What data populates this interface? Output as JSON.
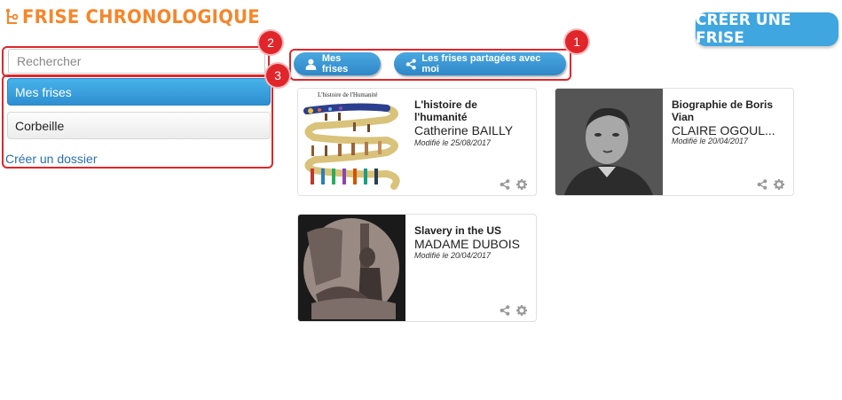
{
  "header": {
    "logo_icon": "timeline-logo-icon",
    "title": "FRISE CHRONOLOGIQUE",
    "create_button": "CRÉER UNE FRISE"
  },
  "sidebar": {
    "search_placeholder": "Rechercher",
    "items": [
      {
        "label": "Mes frises",
        "active": true
      },
      {
        "label": "Corbeille",
        "active": false
      }
    ],
    "create_folder": "Créer un dossier"
  },
  "toolbar": {
    "mine_label": "Mes frises",
    "mine_icon": "user-icon",
    "shared_label": "Les frises partagées avec moi",
    "shared_icon": "share-icon"
  },
  "annotations": [
    "1",
    "2",
    "3"
  ],
  "cards": [
    {
      "title": "L'histoire de l'humanité",
      "author": "Catherine BAILLY",
      "date": "Modifié le 25/08/2017",
      "thumb_caption": "L'histoire de l'Humanité"
    },
    {
      "title": "Biographie de Boris Vian",
      "author": "CLAIRE OGOUL...",
      "date": "Modifié le 20/04/2017"
    },
    {
      "title": "Slavery in the US",
      "author": "MADAME DUBOIS",
      "date": "Modifié le 20/04/2017"
    }
  ],
  "colors": {
    "accent": "#3fa6e0",
    "logo": "#f5862a",
    "annotation": "#e0262b"
  }
}
